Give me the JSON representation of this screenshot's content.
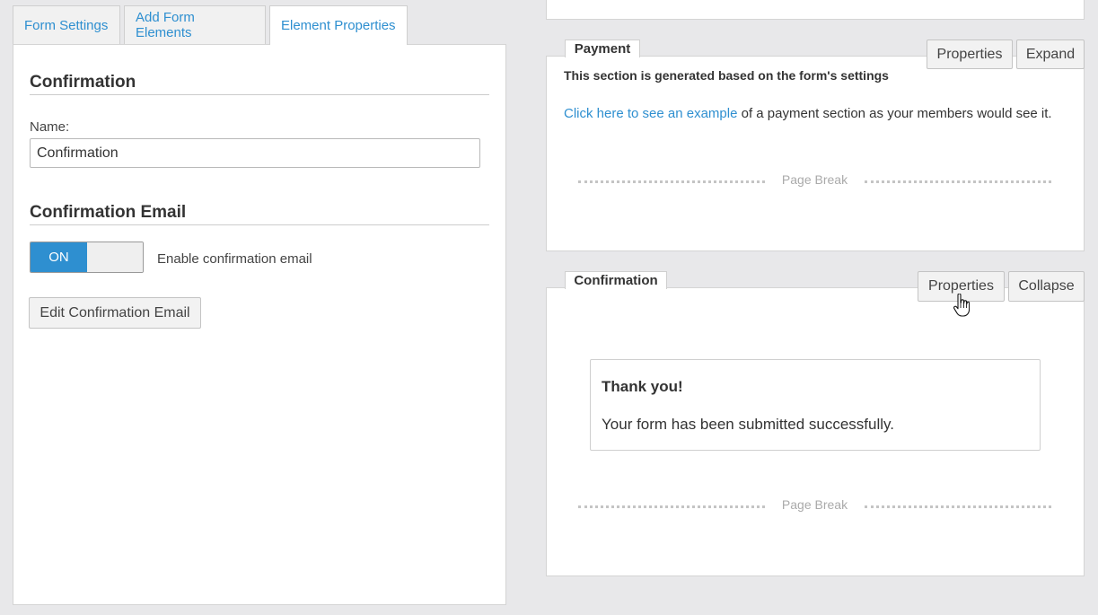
{
  "tabs": [
    {
      "label": "Form Settings",
      "active": false
    },
    {
      "label": "Add Form Elements",
      "active": false
    },
    {
      "label": "Element Properties",
      "active": true
    }
  ],
  "properties_panel": {
    "heading": "Confirmation",
    "name_label": "Name:",
    "name_value": "Confirmation",
    "email_heading": "Confirmation Email",
    "toggle_state": "ON",
    "toggle_label": "Enable confirmation email",
    "edit_email_button": "Edit Confirmation Email"
  },
  "payment_section": {
    "legend": "Payment",
    "properties_button": "Properties",
    "expand_button": "Expand",
    "note": "This section is generated based on the form's settings",
    "link_text": "Click here to see an example",
    "text_after_link": " of a payment section as your members would see it.",
    "page_break": "Page Break"
  },
  "confirmation_section": {
    "legend": "Confirmation",
    "properties_button": "Properties",
    "collapse_button": "Collapse",
    "thank_you_title": "Thank you!",
    "thank_you_message": "Your form has been submitted successfully.",
    "page_break": "Page Break"
  },
  "colors": {
    "accent": "#2e8fd0",
    "background": "#e8e8ea",
    "panel": "#ffffff"
  },
  "icons": {
    "cursor": "hand-pointer-icon"
  }
}
